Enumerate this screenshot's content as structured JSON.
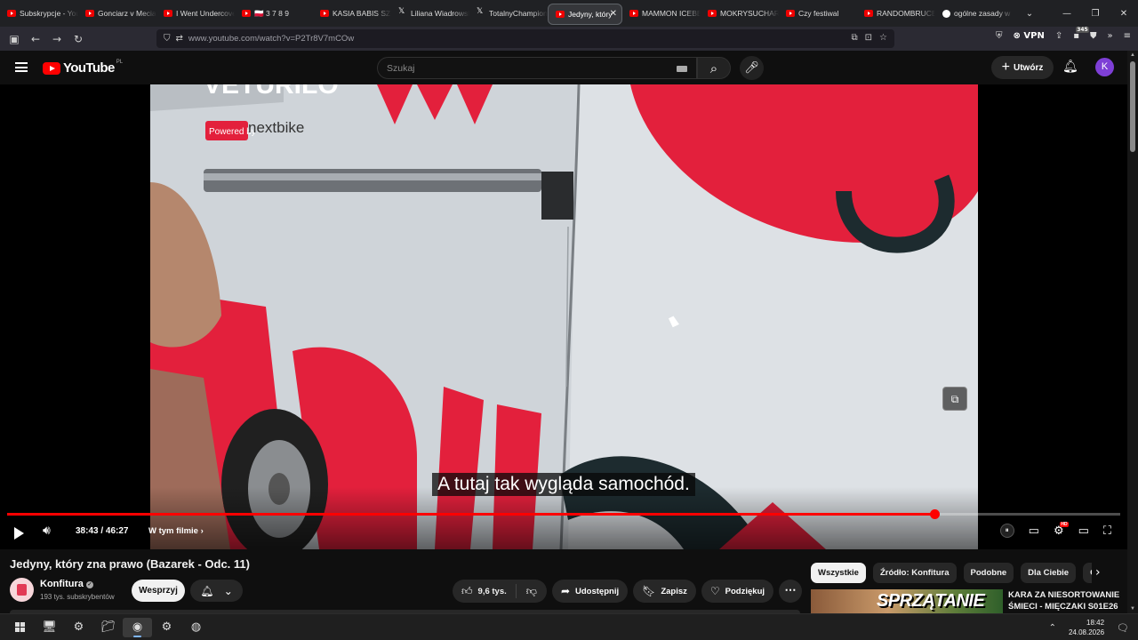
{
  "browser": {
    "tabs": [
      {
        "label": "Subskrypcje - YouTube",
        "icon": "youtube-icon"
      },
      {
        "label": "Gonciarz v Meciarz",
        "icon": "youtube-icon"
      },
      {
        "label": "I Went Undercover",
        "icon": "youtube-icon"
      },
      {
        "label": "🇵🇱 3 7 8 9",
        "icon": "youtube-icon"
      },
      {
        "label": "KASIA BABIS SZCZ",
        "icon": "youtube-icon"
      },
      {
        "label": "Liliana Wiadrowska",
        "icon": "x-icon"
      },
      {
        "label": "TotalnyChampion",
        "icon": "x-icon"
      },
      {
        "label": "Jedyny, który",
        "icon": "youtube-icon",
        "active": true
      },
      {
        "label": "MAMMON ICEBERG",
        "icon": "youtube-icon"
      },
      {
        "label": "MOKRYSUCHAR",
        "icon": "youtube-icon"
      },
      {
        "label": "Czy festiwal",
        "icon": "youtube-icon"
      },
      {
        "label": "RANDOMBRUCE",
        "icon": "youtube-icon"
      },
      {
        "label": "ogólne zasady w",
        "icon": "google-icon"
      }
    ],
    "url": "www.youtube.com/watch?v=P2Tr8V7mCOw",
    "vpn_label": "VPN",
    "extension_badge": "345"
  },
  "youtube": {
    "logo_text": "YouTube",
    "region": "PL",
    "search_placeholder": "Szukaj",
    "create_label": "Utwórz",
    "avatar_letter": "K"
  },
  "player": {
    "subtitle": "A tutaj tak wygląda samochód.",
    "current_time": "38:43",
    "duration": "46:27",
    "time_display": "38:43 / 46:27",
    "progress_fraction": 0.8334,
    "chapters_label": "W tym filmie",
    "van_text": "nextbike",
    "van_powered": "Powered by",
    "van_brand": "VETURILO"
  },
  "video": {
    "title": "Jedyny, który zna prawo (Bazarek - Odc. 11)",
    "channel": "Konfitura",
    "subscribers": "193 tys. subskrybentów",
    "support_label": "Wesprzyj",
    "likes": "9,6 tys.",
    "share_label": "Udostępnij",
    "save_label": "Zapisz",
    "thanks_label": "Podziękuj"
  },
  "sidebar": {
    "chips": [
      {
        "label": "Wszystkie",
        "active": true
      },
      {
        "label": "Źródło: Konfitura"
      },
      {
        "label": "Podobne"
      },
      {
        "label": "Dla Ciebie"
      },
      {
        "label": "Ostatnio przesłane"
      }
    ],
    "suggestion": {
      "thumb_text": "SPRZĄTANIE",
      "title": "KARA ZA NIESORTOWANIE ŚMIECI - MIĘCZAKI S01E26"
    }
  },
  "taskbar": {
    "time": "18:42",
    "date": "24.08.2026"
  },
  "colors": {
    "youtube_red": "#ff0000",
    "background": "#0f0f0f",
    "chip_bg": "#272727",
    "van_red": "#e3203c"
  }
}
